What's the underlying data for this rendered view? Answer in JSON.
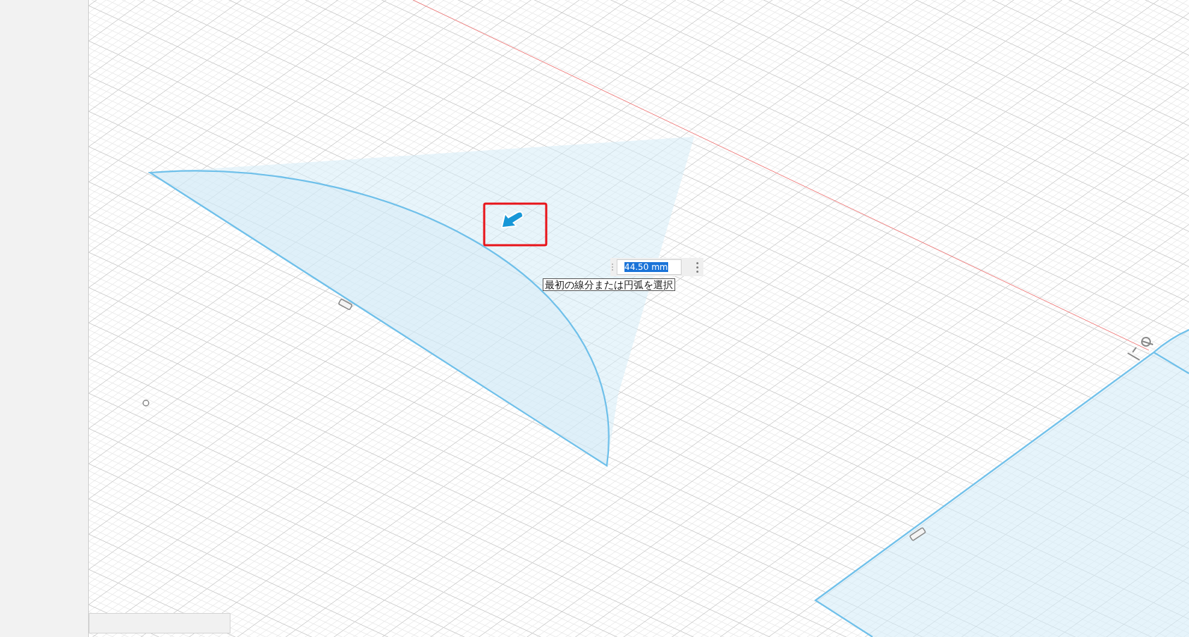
{
  "dimension_input": {
    "value": "44.50 mm",
    "text_selected": true
  },
  "tooltip": {
    "text": "最初の線分または円弧を選択"
  }
}
